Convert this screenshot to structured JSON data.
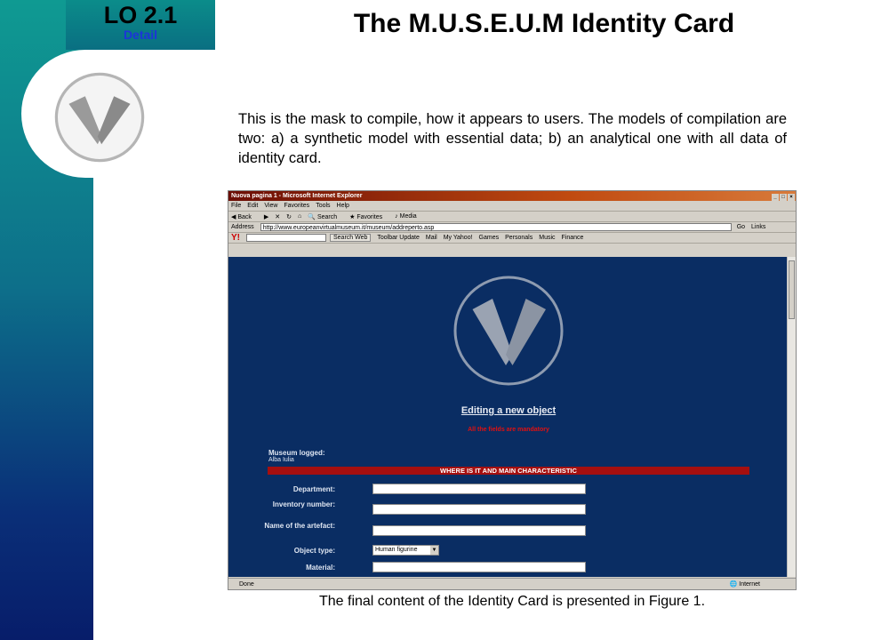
{
  "slide": {
    "lo_title": "LO 2.1",
    "lo_sub": "Detail",
    "title": "The M.U.S.E.U.M Identity Card",
    "paragraph": "This is the mask to compile, how it appears to users. The models of compilation are two: a) a synthetic model with essential data; b) an analytical one with all data of identity card.",
    "caption": "The final content of the Identity Card is presented in Figure 1."
  },
  "browser": {
    "window_title": "Nuova pagina 1 - Microsoft Internet Explorer",
    "menu": [
      "File",
      "Edit",
      "View",
      "Favorites",
      "Tools",
      "Help"
    ],
    "toolbar": [
      "Back",
      "Search",
      "Favorites",
      "Media"
    ],
    "address_label": "Address",
    "address_url": "http://www.europeanvirtualmuseum.it/museum/addreperto.asp",
    "go_label": "Go",
    "links_label": "Links",
    "yahoo": {
      "logo": "Y!",
      "search_button": "Search Web",
      "items": [
        "Toolbar Update",
        "Mail",
        "My Yahoo!",
        "Games",
        "Personals",
        "Music",
        "Finance"
      ]
    },
    "status_left": "Done",
    "status_right": "Internet"
  },
  "form": {
    "heading": "Editing a new object",
    "mandatory": "All the fields are mandatory",
    "museum_label": "Museum logged:",
    "museum_value": "Alba Iulia",
    "section_title": "WHERE IS IT AND MAIN CHARACTERISTIC",
    "fields": {
      "department": "Department:",
      "inventory": "Inventory number:",
      "artefact": "Name of the artefact:",
      "object_type": "Object type:",
      "material": "Material:"
    },
    "object_type_value": "Human figurine"
  },
  "colors": {
    "page_bg": "#0a2d63",
    "section_bar": "#a50f0f",
    "mandatory": "#e01010",
    "lo_sub": "#1c35d8"
  }
}
